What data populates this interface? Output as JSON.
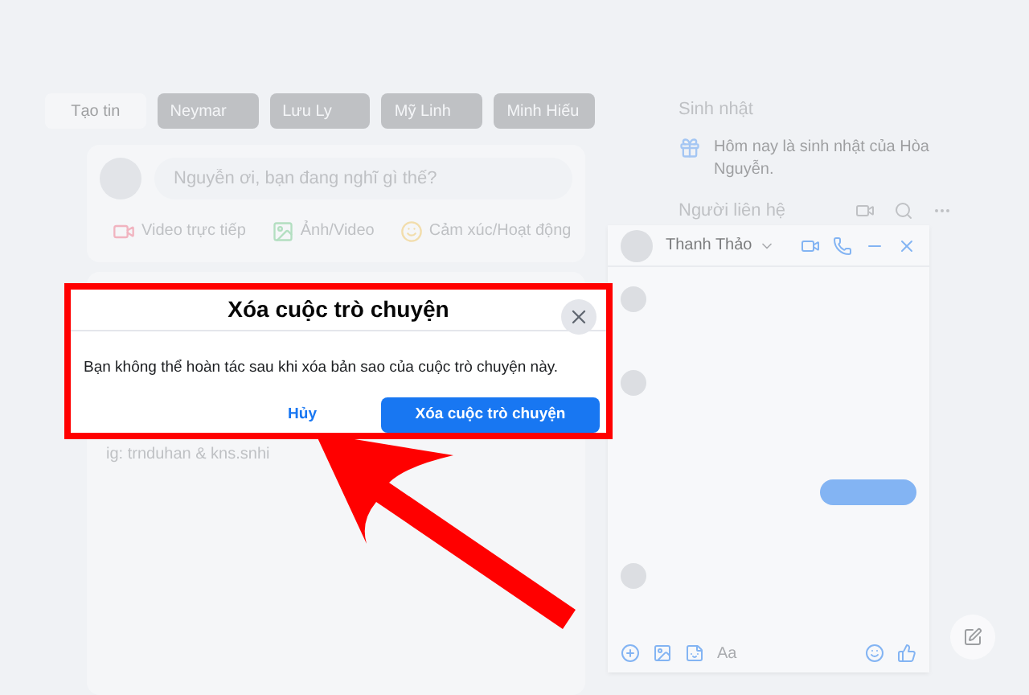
{
  "stories": [
    {
      "label": "Tạo tin",
      "kind": "create"
    },
    {
      "label": "Neymar",
      "kind": "story"
    },
    {
      "label": "Lưu Ly",
      "kind": "story"
    },
    {
      "label": "Mỹ Linh",
      "kind": "story"
    },
    {
      "label": "Minh Hiếu",
      "kind": "story"
    }
  ],
  "composer": {
    "placeholder": "Nguyễn ơi, bạn đang nghĩ gì thế?",
    "actions": [
      {
        "label": "Video trực tiếp",
        "kind": "live"
      },
      {
        "label": "Ảnh/Video",
        "kind": "photo"
      },
      {
        "label": "Cảm xúc/Hoạt động",
        "kind": "feeling"
      }
    ]
  },
  "post": {
    "caption": "ig: trnduhan & kns.snhi"
  },
  "birthdays": {
    "title": "Sinh nhật",
    "text": "Hôm nay là sinh nhật của Hòa Nguyễn."
  },
  "contacts": {
    "title": "Người liên hệ"
  },
  "chat": {
    "name": "Thanh Thảo",
    "placeholder": "Aa"
  },
  "dialog": {
    "title": "Xóa cuộc trò chuyện",
    "message": "Bạn không thể hoàn tác sau khi xóa bản sao của cuộc trò chuyện này.",
    "cancel": "Hủy",
    "confirm": "Xóa cuộc trò chuyện"
  }
}
